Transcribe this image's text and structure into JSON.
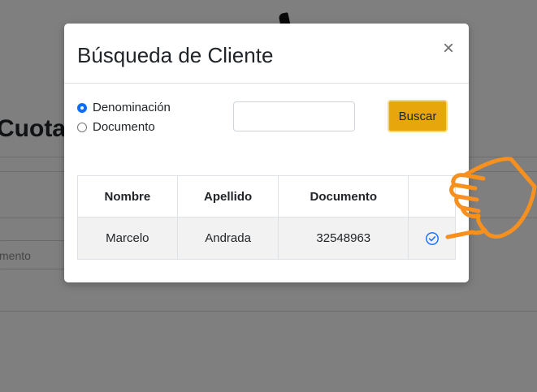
{
  "background": {
    "page_title": "Cuotas",
    "input_fragment": "mento"
  },
  "modal": {
    "title": "Búsqueda de Cliente",
    "close_label": "×",
    "search_options": [
      {
        "label": "Denominación",
        "checked": true
      },
      {
        "label": "Documento",
        "checked": false
      }
    ],
    "search_input": {
      "value": "",
      "placeholder": ""
    },
    "search_button_label": "Buscar",
    "table": {
      "headers": [
        "Nombre",
        "Apellido",
        "Documento",
        ""
      ],
      "rows": [
        {
          "nombre": "Marcelo",
          "apellido": "Andrada",
          "documento": "32548963",
          "action_icon": "check-circle-icon"
        }
      ]
    }
  },
  "colors": {
    "primary": "#0d6efd",
    "button_accent": "#e6a60c",
    "pointer_annotation": "#f7901e"
  }
}
